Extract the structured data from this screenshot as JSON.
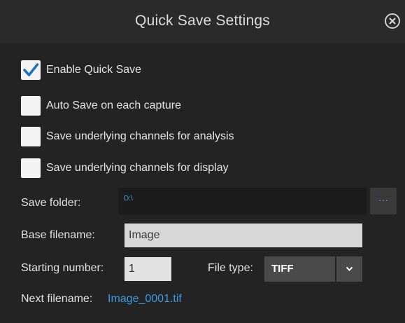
{
  "dialog": {
    "title": "Quick Save Settings",
    "close_icon": "close-circle-icon"
  },
  "options": [
    {
      "label": "Enable Quick Save",
      "checked": true
    },
    {
      "label": "Auto Save on each capture",
      "checked": false
    },
    {
      "label": "Save underlying channels for analysis",
      "checked": false
    },
    {
      "label": "Save underlying channels for display",
      "checked": false
    }
  ],
  "save_folder": {
    "label": "Save folder:",
    "value": "D:\\",
    "browse_label": "···"
  },
  "base_filename": {
    "label": "Base filename:",
    "value": "Image"
  },
  "starting_number": {
    "label": "Starting number:",
    "value": "1"
  },
  "file_type": {
    "label": "File type:",
    "selected": "TIFF",
    "arrow_icon": "chevron-down-icon"
  },
  "next_filename": {
    "label": "Next filename:",
    "value": "Image_0001.tif"
  },
  "colors": {
    "background": "#232323",
    "titlebar": "#2a2a2a",
    "accent": "#3c9be6",
    "checkmark": "#1e73be"
  }
}
